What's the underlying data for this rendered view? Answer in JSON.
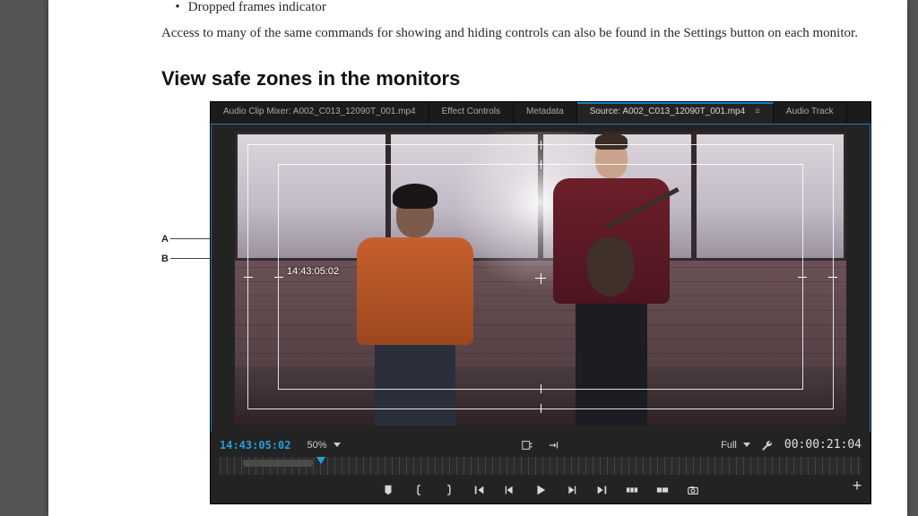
{
  "doc": {
    "bullet_last": "Dropped frames indicator",
    "para_settings": "Access to many of the same commands for showing and hiding controls can also be found in the Settings button on each monitor.",
    "heading_safe": "View safe zones in the monitors"
  },
  "callouts": {
    "A": "A",
    "B": "B"
  },
  "panel": {
    "tabs": {
      "mixer": "Audio Clip Mixer: A002_C013_12090T_001.mp4",
      "effect": "Effect Controls",
      "meta": "Metadata",
      "source": "Source: A002_C013_12090T_001.mp4",
      "audiotrack": "Audio Track"
    },
    "close_glyph": "≡",
    "overlay_tc": "14:43:05:02",
    "info": {
      "timecode": "14:43:05:02",
      "zoom": "50%",
      "fit": "Full",
      "duration": "00:00:21:04"
    },
    "transport": {
      "marker": "marker",
      "in": "{",
      "out": "}",
      "goto_in": "go-to-in",
      "step_back": "step-back",
      "play": "play",
      "step_fwd": "step-forward",
      "goto_out": "go-to-out",
      "insert": "insert",
      "overwrite": "overwrite",
      "snapshot": "snapshot"
    }
  }
}
